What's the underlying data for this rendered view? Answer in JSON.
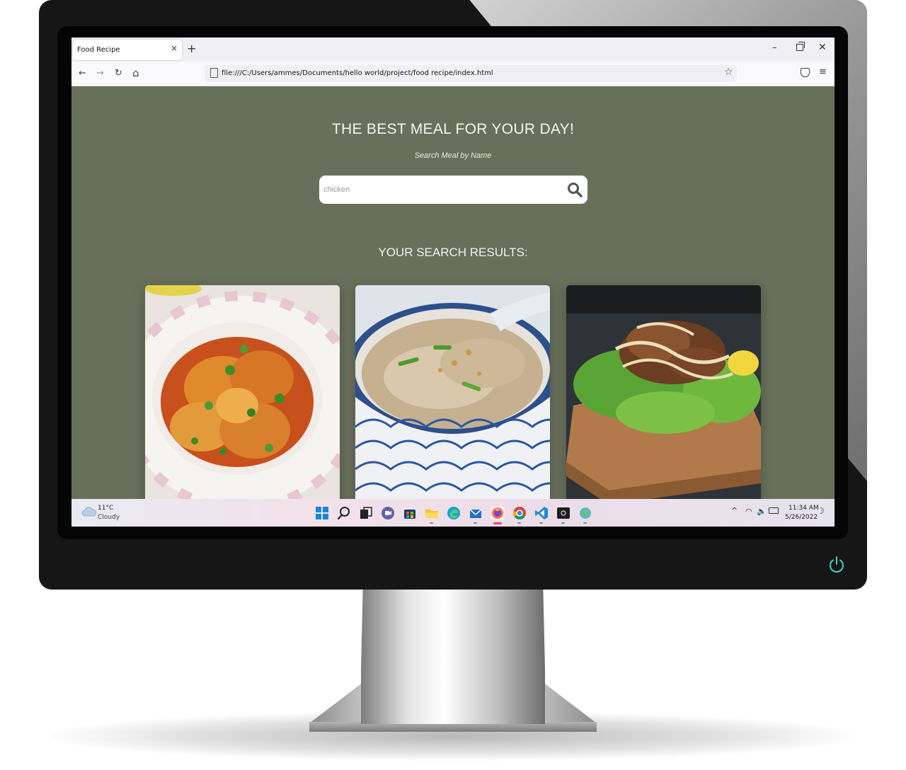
{
  "browser": {
    "tab_title": "Food Recipe",
    "tab_close": "×",
    "new_tab": "+",
    "url": "file:///C:/Users/ammes/Documents/hello world/project/food recipe/index.html",
    "window_min": "–",
    "window_close": "✕",
    "back": "←",
    "forward": "→",
    "reload": "↻",
    "home": "⌂",
    "bookmark": "☆",
    "menu": "≡"
  },
  "page": {
    "title": "THE BEST MEAL FOR YOUR DAY!",
    "subtitle": "Search Meal by Name",
    "search": {
      "value": "chicken",
      "placeholder": "chicken"
    },
    "results_heading": "YOUR SEARCH RESULTS:",
    "results": [
      {
        "image": "chicken-curry-plate"
      },
      {
        "image": "chicken-rice-porridge-bowl"
      },
      {
        "image": "grilled-chicken-lettuce-board"
      }
    ],
    "colors": {
      "background": "#68705b",
      "text": "#f4f4ee"
    }
  },
  "taskbar": {
    "weather_temp": "11°C",
    "weather_condition": "Cloudy",
    "clock_time": "11:34 AM",
    "clock_date": "5/26/2022",
    "tray_chevron": "^",
    "tray_wifi": "◠",
    "tray_volume": "🔈",
    "moon": "☽",
    "apps": [
      "windows-start",
      "search",
      "task-view",
      "teams-chat",
      "store",
      "file-explorer",
      "edge",
      "mail",
      "firefox",
      "chrome",
      "vscode",
      "terminal",
      "photos"
    ]
  }
}
